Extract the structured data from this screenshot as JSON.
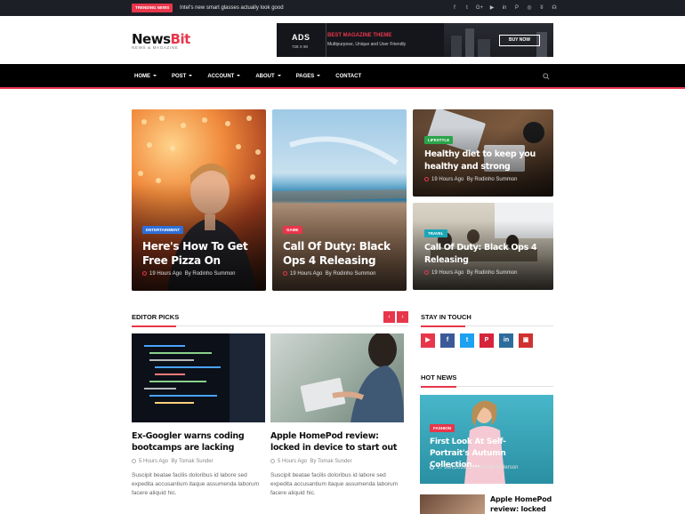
{
  "topbar": {
    "badge": "TRENDING NEWS",
    "headline": "Intel's new smart glasses actually look good",
    "social": [
      "f",
      "t",
      "G+",
      "▶",
      "in",
      "P",
      "◎",
      "ʬ",
      "☊"
    ]
  },
  "header": {
    "logo_main": "News",
    "logo_accent": "Bit",
    "logo_sub": "NEWS & MAGAZINE"
  },
  "ad": {
    "title": "ADS",
    "size": "728 X 90",
    "heading": "BEST MAGAZINE THEME",
    "desc": "Multipurpose, Unique and User Friendly",
    "button": "BUY NOW"
  },
  "nav": {
    "items": [
      "HOME",
      "POST",
      "ACCOUNT",
      "ABOUT",
      "PAGES",
      "CONTACT"
    ]
  },
  "hero": {
    "main1": {
      "category": "ENTERTAINMENT",
      "title": "Here's How To Get Free Pizza On",
      "time": "19 Hours Ago",
      "by": "By",
      "author": "Rodinho Summon"
    },
    "main2": {
      "category": "GAME",
      "title": "Call Of Duty: Black Ops 4 Releasing",
      "time": "19 Hours Ago",
      "by": "By",
      "author": "Rodinho Summon"
    },
    "side1": {
      "category": "LIFESTYLE",
      "title": "Healthy diet to keep you healthy and strong",
      "time": "19 Hours Ago",
      "by": "By",
      "author": "Rodinho Summon"
    },
    "side2": {
      "category": "TRAVEL",
      "title": "Call Of Duty: Black Ops 4 Releasing",
      "time": "19 Hours Ago",
      "by": "By",
      "author": "Rodinho Summon"
    }
  },
  "editor_picks": {
    "title": "EDITOR PICKS",
    "prev": "‹",
    "next": "›",
    "posts": [
      {
        "title": "Ex-Googler warns coding bootcamps are lacking",
        "time": "5 Hours Ago",
        "by": "By",
        "author": "Tomak Sunder",
        "excerpt": "Suscipit beatae facilis doloribus id labore sed expedita accusantium itaque assumenda laborum facere aliquid hic."
      },
      {
        "title": "Apple HomePod review: locked in device to start out",
        "time": "5 Hours Ago",
        "by": "By",
        "author": "Tomak Sunder",
        "excerpt": "Suscipit beatae facilis doloribus id labore sed expedita accusantium itaque assumenda laborum facere aliquid hic."
      }
    ]
  },
  "stay_in_touch": {
    "title": "STAY IN TOUCH",
    "buttons": [
      "▶",
      "f",
      "t",
      "P",
      "in",
      "▣"
    ]
  },
  "hot_news": {
    "title": "HOT NEWS",
    "feature": {
      "category": "FASHION",
      "title": "First Look At Self-Portrait's Autumn Collection...",
      "date": "17 Jun,2019",
      "by": "By",
      "author": "Jammy Anderson"
    },
    "small": {
      "title": "Apple HomePod review: locked in"
    }
  },
  "colors": {
    "accent": "#e8364b",
    "dark": "#1d1f27",
    "entertainment": "#2f6fd8",
    "game": "#e8364b",
    "lifestyle": "#2aa44a",
    "travel": "#1aa6b7"
  }
}
